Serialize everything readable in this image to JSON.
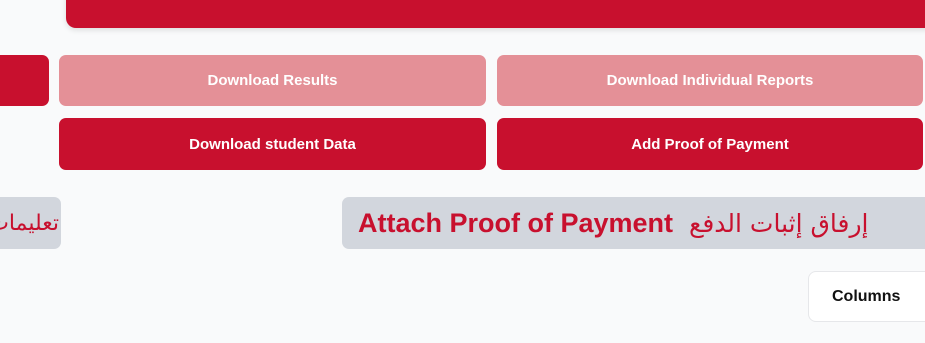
{
  "colors": {
    "brand_red": "#c8102e",
    "brand_red_light": "#e49097",
    "tag_bg": "#d2d6dd"
  },
  "buttons": {
    "download_results": "Download Results",
    "download_individual_reports": "Download Individual Reports",
    "download_student_data": "Download student Data",
    "add_proof_of_payment": "Add Proof of Payment"
  },
  "attach_tag": {
    "english": "Attach Proof of Payment",
    "arabic": "إرفاق إثبات الدفع"
  },
  "left_tag": {
    "arabic": "تعليمات"
  },
  "table_toolbar": {
    "columns_label": "Columns"
  }
}
